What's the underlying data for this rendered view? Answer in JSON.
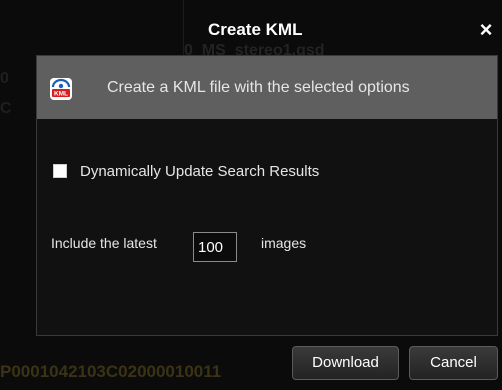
{
  "window": {
    "title": "Create KML",
    "close_symbol": "×"
  },
  "background": {
    "top_fragment": "0_MS_stereo1.gsd",
    "bottom_fragment": "P0001042103C02000010011",
    "left_fragment_1": "0",
    "left_fragment_2": "C"
  },
  "dialog": {
    "icon": "kml-file-icon",
    "header_text": "Create a KML file with the selected options",
    "checkbox": {
      "label": "Dynamically Update Search Results",
      "checked": false
    },
    "latest": {
      "prefix": "Include the latest",
      "value": "100",
      "suffix": "images"
    }
  },
  "buttons": {
    "download_label": "Download",
    "cancel_label": "Cancel"
  },
  "colors": {
    "background": "#0b0b0b",
    "header_band": "#5f5f5f",
    "text": "#e6e6e6",
    "icon_accent": "#1a5fb4"
  }
}
